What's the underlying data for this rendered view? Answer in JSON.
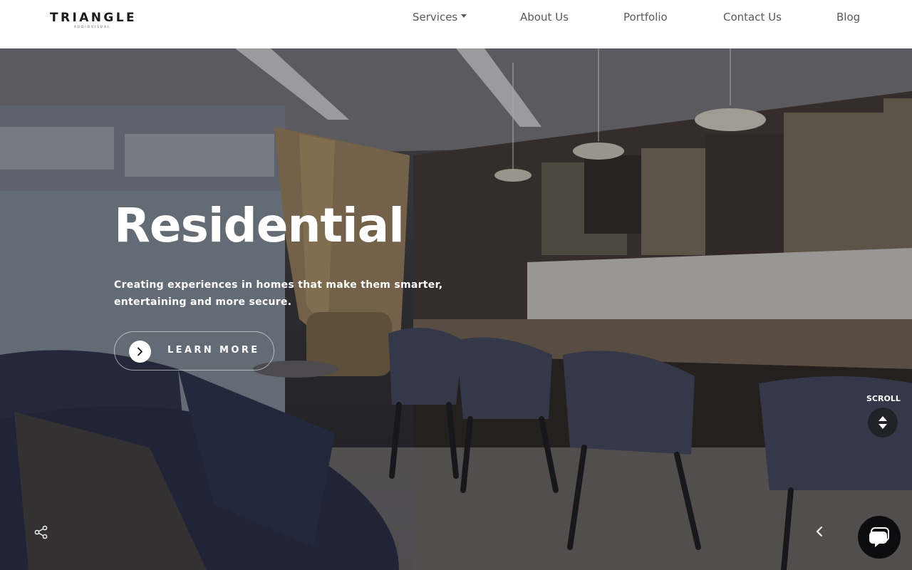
{
  "header": {
    "logo": {
      "word": "TRIANGLE",
      "sub": "AUDIOVISUAL"
    },
    "nav": [
      {
        "label": "Services",
        "has_dropdown": true
      },
      {
        "label": "About Us"
      },
      {
        "label": "Portfolio"
      },
      {
        "label": "Contact Us"
      },
      {
        "label": "Blog"
      }
    ]
  },
  "hero": {
    "title": "Residential",
    "description": "Creating experiences in homes that make them smarter, entertaining and more secure.",
    "cta_label": "LEARN MORE",
    "scroll_label": "SCROLL"
  },
  "icons": {
    "cta": "chevron-right-icon",
    "scroll": "scroll-arrows-icon",
    "share": "share-icon",
    "prev": "chevron-left-icon",
    "chat": "chat-icon"
  },
  "colors": {
    "header_bg": "#ffffff",
    "nav_text": "#5a5a5a",
    "hero_text": "#ffffff",
    "chat_bg": "#0d0d10"
  }
}
